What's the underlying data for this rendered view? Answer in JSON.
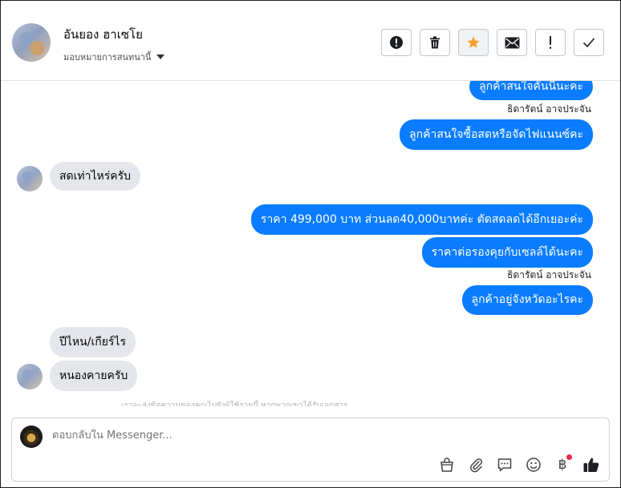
{
  "header": {
    "contact_name": "อันยอง ฮาเซโย",
    "assign_label": "มอบหมายการสนทนานี้"
  },
  "toolbar": {
    "buttons": [
      {
        "icon": "alert-circle-icon"
      },
      {
        "icon": "trash-icon"
      },
      {
        "icon": "star-icon",
        "color": "#f59e2e"
      },
      {
        "icon": "envelope-icon"
      },
      {
        "icon": "exclamation-icon"
      },
      {
        "icon": "check-icon"
      }
    ]
  },
  "messages": [
    {
      "dir": "out",
      "text": "ลูกค้าสนใจคันนี้นะคะ"
    },
    {
      "dir": "sender",
      "text": "ธิดารัตน์ อาจประจัน"
    },
    {
      "dir": "out",
      "text": "ลูกค้าสนใจซื้อสดหรือจัดไฟแนนซ์คะ"
    },
    {
      "dir": "in",
      "text": "สดเท่าไหร่ครับ"
    },
    {
      "dir": "out",
      "text": "ราคา 499,000 บาท ส่วนลด40,000บาทค่ะ ตัดสดลดได้อีกเยอะค่ะ"
    },
    {
      "dir": "out",
      "text": "ราคาต่อรองคุยกับเซลล์ได้นะคะ"
    },
    {
      "dir": "sender",
      "text": "ธิดารัตน์ อาจประจัน"
    },
    {
      "dir": "out",
      "text": "ลูกค้าอยู่จังหวัดอะไรคะ"
    },
    {
      "dir": "in",
      "text": "ปีไหน/เกียร์ไร"
    },
    {
      "dir": "in",
      "text": "หนองคายครับ"
    }
  ],
  "faded_notice": "เราจะส่งข้อความของคุณไปยังผู้ใช้รายนี้ หากพวกเขาได้รับเอกสาร",
  "composer": {
    "placeholder": "ตอบกลับใน Messenger...",
    "tools": [
      "shopping-bag-icon",
      "paperclip-icon",
      "saved-reply-icon",
      "emoji-icon",
      "baht-icon",
      "thumbs-up-icon"
    ],
    "baht_symbol": "฿",
    "accent": "#0a7cff",
    "notification_dot_color": "#f0284a"
  }
}
